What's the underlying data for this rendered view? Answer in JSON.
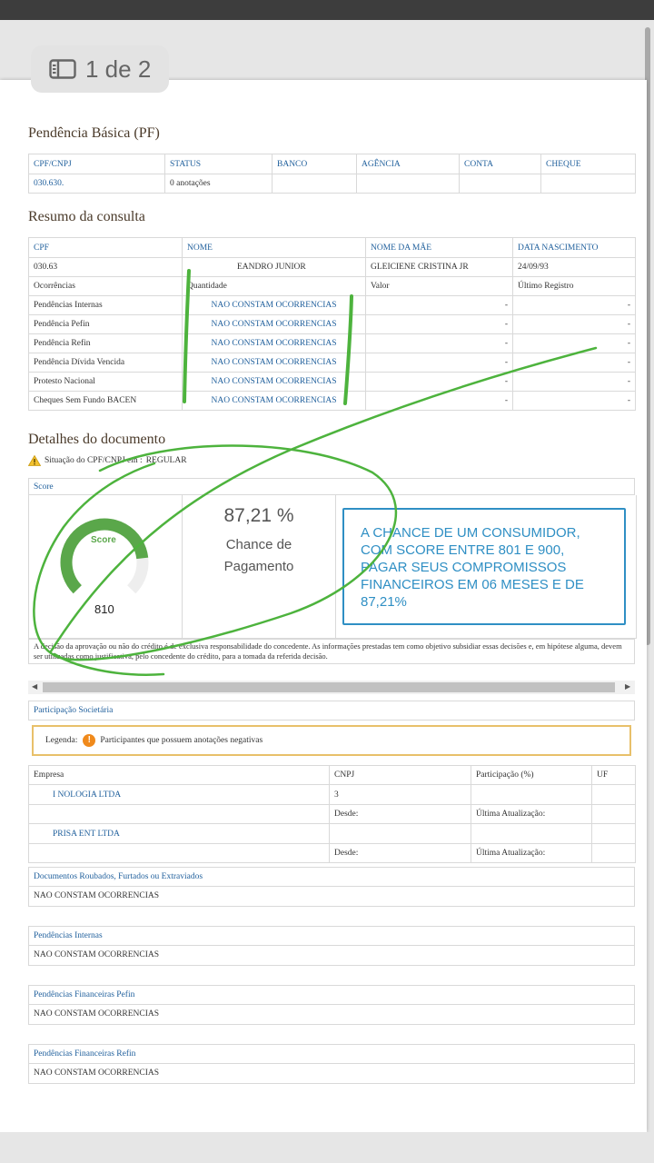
{
  "pager": {
    "label": "1 de 2"
  },
  "pendencia_basica": {
    "title": "Pendência Básica (PF)",
    "headers": [
      "CPF/CNPJ",
      "STATUS",
      "BANCO",
      "AGÊNCIA",
      "CONTA",
      "CHEQUE"
    ],
    "row": [
      "030.630.",
      "0 anotações",
      "",
      "",
      "",
      ""
    ]
  },
  "resumo": {
    "title": "Resumo da consulta",
    "headers": [
      "CPF",
      "NOME",
      "NOME DA MÃE",
      "DATA NASCIMENTO"
    ],
    "person": [
      "030.63",
      "EANDRO JUNIOR",
      "GLEICIENE CRISTINA JR",
      "24/09/93"
    ],
    "subheaders": [
      "Ocorrências",
      "Quantidade",
      "Valor",
      "Último Registro"
    ],
    "rows": [
      {
        "label": "Pendências Internas",
        "qty": "NAO CONSTAM OCORRENCIAS",
        "valor": "-",
        "ultimo": "-"
      },
      {
        "label": "Pendência Pefin",
        "qty": "NAO CONSTAM OCORRENCIAS",
        "valor": "-",
        "ultimo": "-"
      },
      {
        "label": "Pendência Refin",
        "qty": "NAO CONSTAM OCORRENCIAS",
        "valor": "-",
        "ultimo": "-"
      },
      {
        "label": "Pendência Dívida Vencida",
        "qty": "NAO CONSTAM OCORRENCIAS",
        "valor": "-",
        "ultimo": "-"
      },
      {
        "label": "Protesto Nacional",
        "qty": "NAO CONSTAM OCORRENCIAS",
        "valor": "-",
        "ultimo": "-"
      },
      {
        "label": "Cheques Sem Fundo BACEN",
        "qty": "NAO CONSTAM OCORRENCIAS",
        "valor": "-",
        "ultimo": "-"
      }
    ]
  },
  "detalhes": {
    "title": "Detalhes do documento",
    "situacao": "Situação do CPF/CNPJ em :",
    "situacao_value": "REGULAR"
  },
  "score": {
    "tab": "Score",
    "gauge_label": "Score",
    "value": "810",
    "fraction": 0.81,
    "pct": "87,21 %",
    "pct_caption": "Chance de Pagamento",
    "note": "A CHANCE DE UM CONSUMIDOR, COM SCORE ENTRE 801 E 900, PAGAR SEUS COMPROMISSOS FINANCEIROS EM 06 MESES E DE 87,21%",
    "disclaimer": "A decisão da aprovação ou não do crédito é de exclusiva responsabilidade do concedente. As informações prestadas tem como objetivo subsidiar essas decisões e, em hipótese alguma, devem ser utilizadas como justificativa, pelo concedente do crédito, para a tomada da referida decisão."
  },
  "participacao": {
    "title": "Participação Societária",
    "legend_label": "Legenda:",
    "legend_text": "Participantes que possuem anotações negativas",
    "headers": [
      "Empresa",
      "CNPJ",
      "Participação (%)",
      "UF"
    ],
    "companies": [
      {
        "name": "I                    NOLOGIA LTDA",
        "cnpj": "3",
        "desde": "Desde:",
        "ultima": "Última Atualização:"
      },
      {
        "name": "  PRISA ENT          LTDA",
        "cnpj": "",
        "desde": "Desde:",
        "ultima": "Última Atualização:"
      }
    ]
  },
  "panels": [
    {
      "title": "Documentos Roubados, Furtados ou Extraviados",
      "body": "NAO CONSTAM OCORRENCIAS"
    },
    {
      "title": "Pendências Internas",
      "body": "NAO CONSTAM OCORRENCIAS"
    },
    {
      "title": "Pendências Financeiras Pefin",
      "body": "NAO CONSTAM OCORRENCIAS"
    },
    {
      "title": "Pendências Financeiras Refin",
      "body": "NAO CONSTAM OCORRENCIAS"
    }
  ],
  "colors": {
    "accent": "#1f5f9c",
    "annotation": "#4db33d",
    "note_border": "#2f8fc4",
    "gauge": "#5aa74a"
  }
}
